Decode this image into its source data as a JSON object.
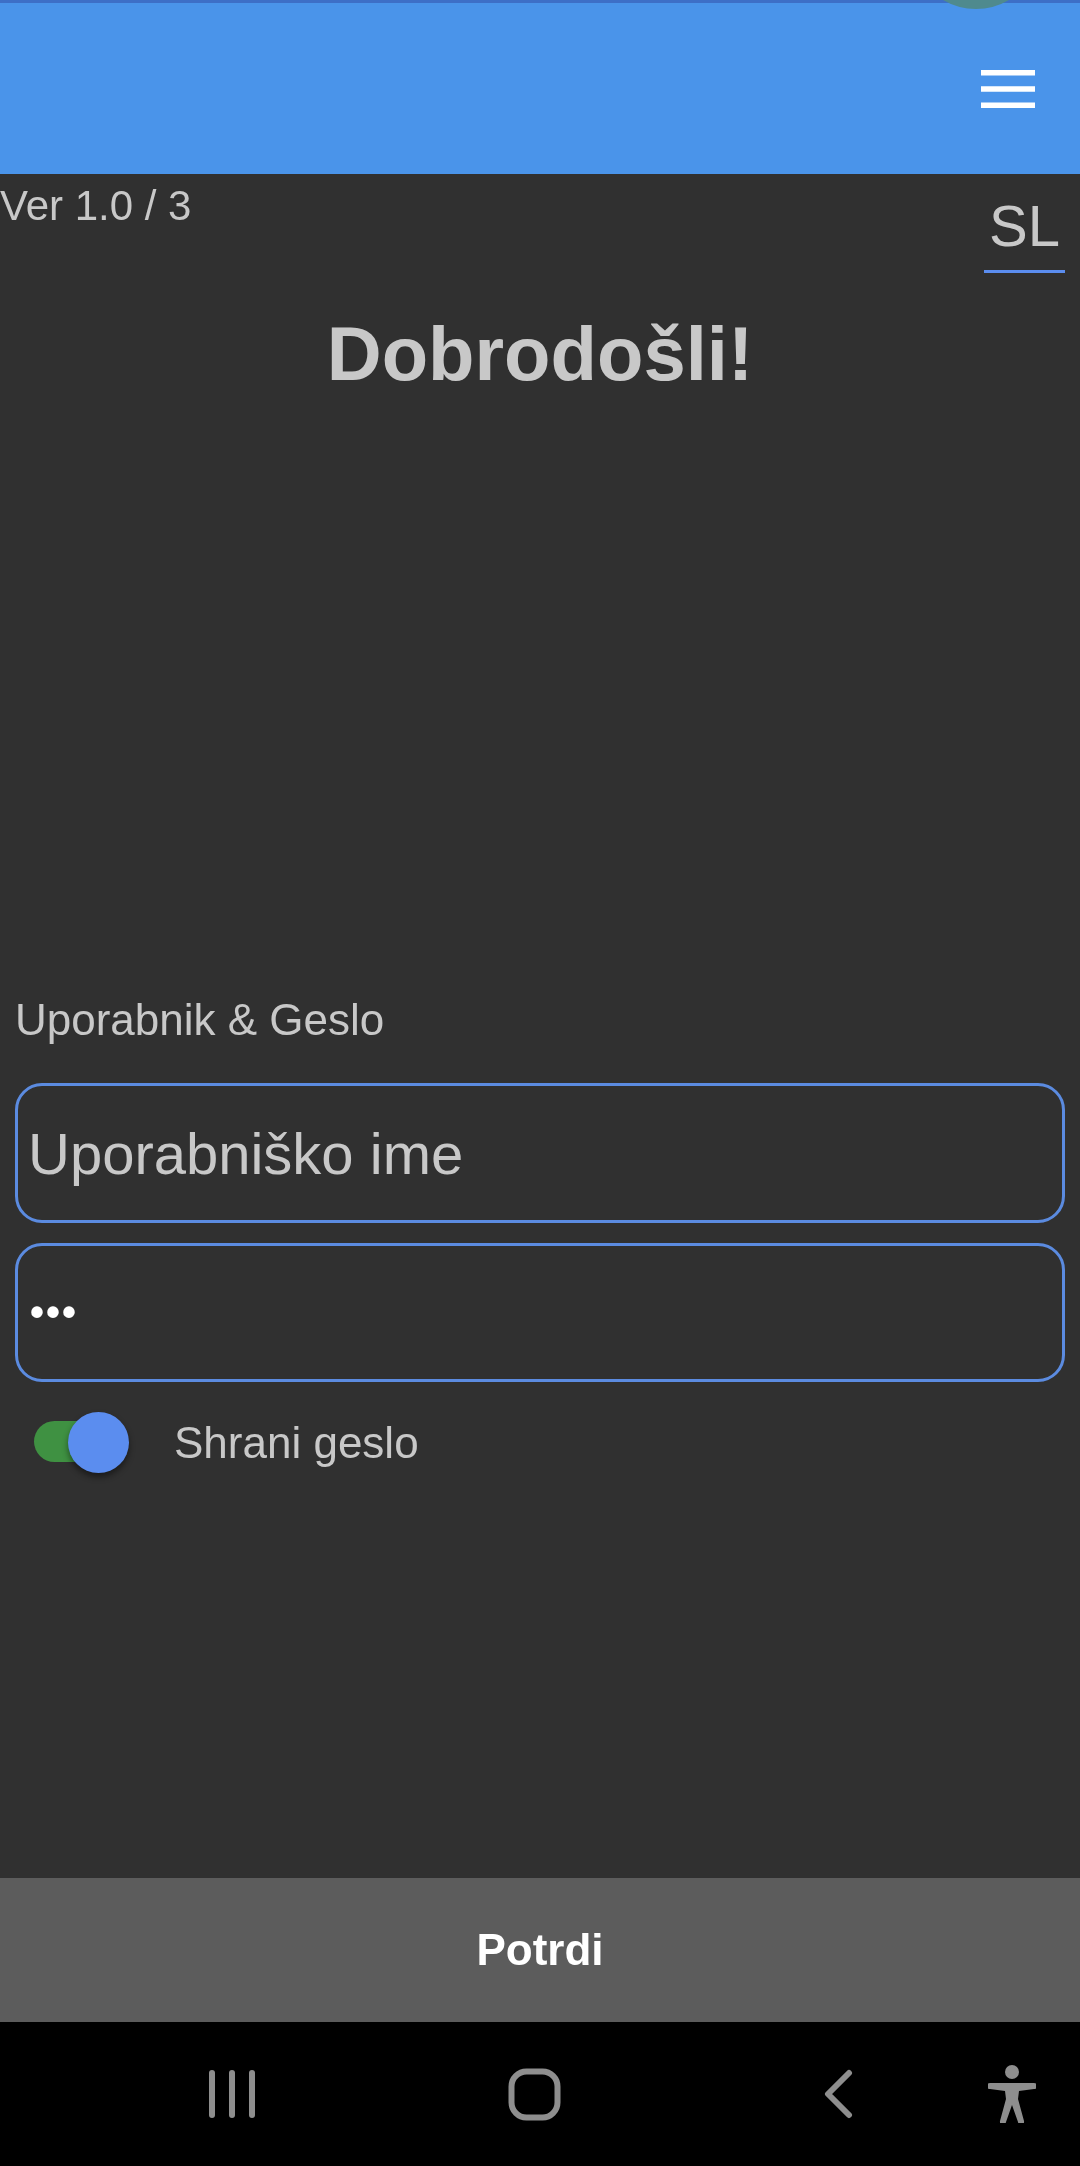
{
  "version": "Ver 1.0 / 3",
  "language": {
    "label": "SL"
  },
  "title": "Dobrodošli!",
  "form": {
    "label": "Uporabnik & Geslo",
    "username": {
      "placeholder": "Uporabniško ime"
    },
    "password": {
      "value": "•••"
    },
    "remember": {
      "label": "Shrani geslo",
      "on": true
    }
  },
  "submit": {
    "label": "Potrdi"
  }
}
